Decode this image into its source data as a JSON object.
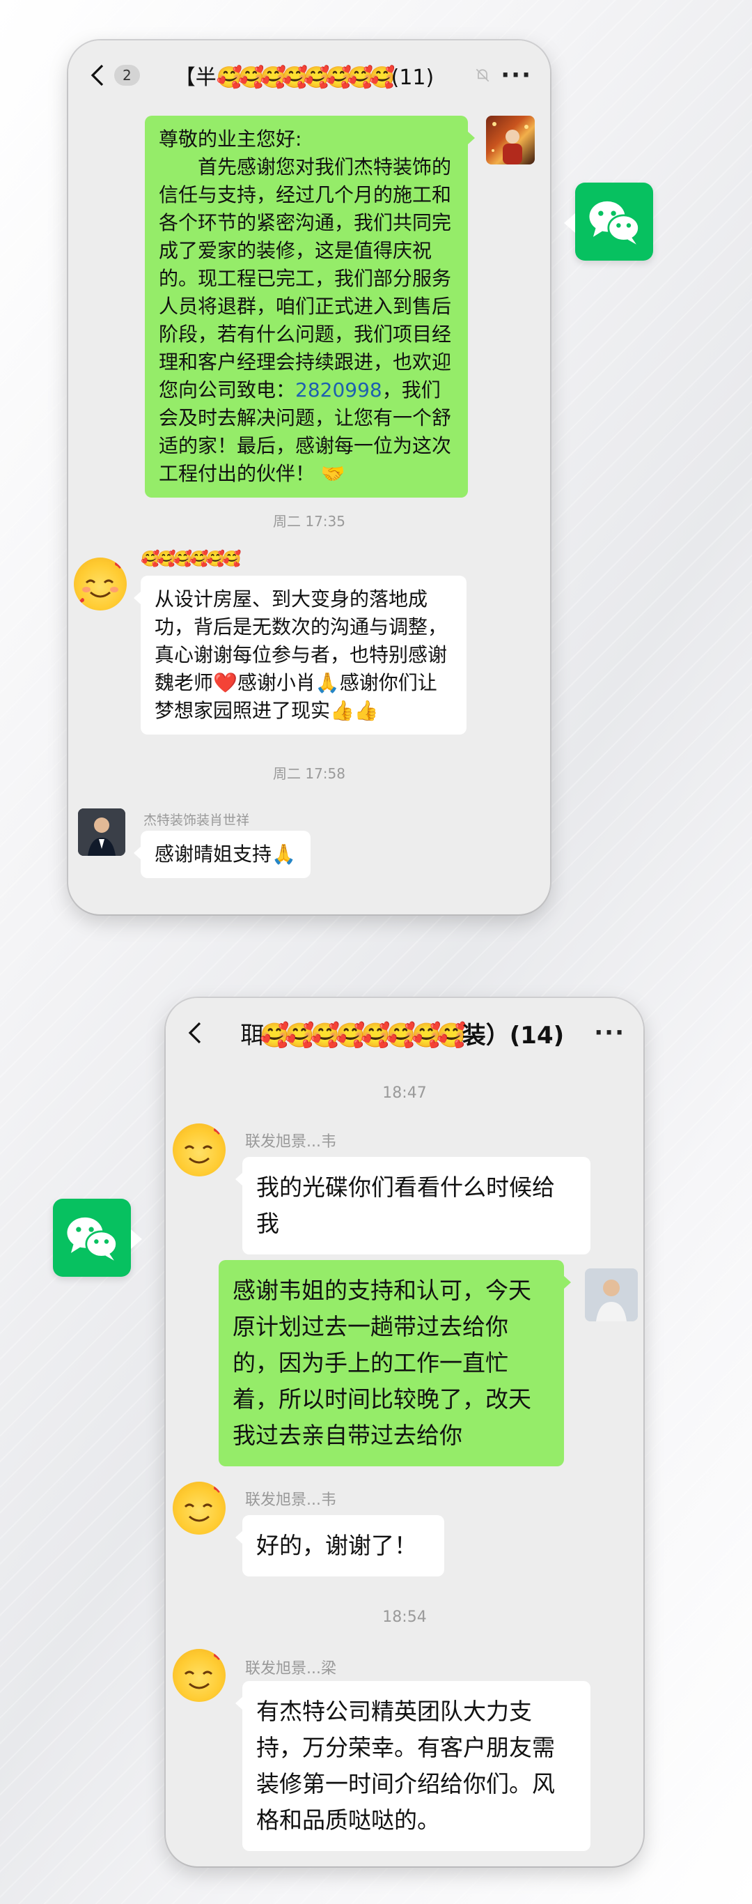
{
  "chat1": {
    "unread_count": "2",
    "title_prefix": "【半",
    "title_emojis": "🥰🥰🥰🥰🥰🥰🥰🥰",
    "title_suffix": "(11)",
    "more": "···",
    "msg1": {
      "line_greeting": "尊敬的业主您好:",
      "body_a": "首先感谢您对我们杰特装饰的信任与支持，经过几个月的施工和各个环节的紧密沟通，我们共同完成了爱家的装修，这是值得庆祝的。现工程已完工，我们部分服务人员将退群，咱们正式进入到售后阶段，若有什么问题，我们项目经理和客户经理会持续跟进，也欢迎您向公司致电：",
      "phone": "2820998",
      "body_b": "，我们会及时去解决问题，让您有一个舒适的家！最后，感谢每一位为这次工程付出的伙伴！",
      "emoji": "🤝"
    },
    "time1": "周二 17:35",
    "msg2": {
      "sender_emojis": "🥰🥰🥰🥰🥰🥰",
      "text": "从设计房屋、到大变身的落地成功，背后是无数次的沟通与调整，真心谢谢每位参与者，也特别感谢魏老师❤️感谢小肖🙏感谢你们让梦想家园照进了现实👍👍"
    },
    "time2": "周二 17:58",
    "msg3": {
      "sender": "杰特装饰装肖世祥",
      "text": "感谢晴姐支持🙏"
    }
  },
  "chat2": {
    "title_emojis": "聑🥰🥰🥰🥰🥰🥰🥰🥰",
    "title_suffix": "装）(14)",
    "more": "···",
    "time1": "18:47",
    "msg1": {
      "sender": "联发旭景...韦",
      "text": "我的光碟你们看看什么时候给我"
    },
    "msg2": {
      "text": "感谢韦姐的支持和认可，今天原计划过去一趟带过去给你的，因为手上的工作一直忙着，所以时间比较晚了，改天我过去亲自带过去给你"
    },
    "msg3": {
      "sender": "联发旭景...韦",
      "text": "好的，谢谢了！"
    },
    "time2": "18:54",
    "msg4": {
      "sender": "联发旭景...梁",
      "text": "有杰特公司精英团队大力支持，万分荣幸。有客户朋友需装修第一时间介绍给你们。风格和品质哒哒的。"
    }
  },
  "colors": {
    "wechat_green": "#07c160",
    "bubble_green": "#95ec69",
    "chat_bg": "#ededed"
  }
}
